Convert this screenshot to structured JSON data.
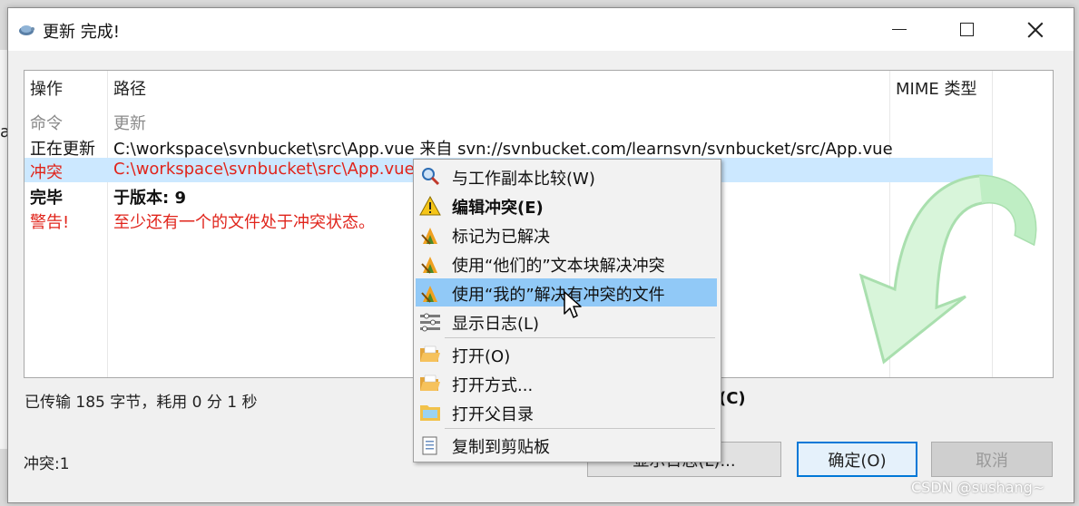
{
  "window": {
    "title": "更新 完成!"
  },
  "list": {
    "headers": {
      "op": "操作",
      "path": "路径",
      "mime": "MIME 类型"
    },
    "rows": [
      {
        "op": "命令",
        "path": "更新"
      },
      {
        "op": "正在更新",
        "path": "C:\\workspace\\svnbucket\\src\\App.vue 来自 svn://svnbucket.com/learnsvn/svnbucket/src/App.vue"
      },
      {
        "op": "冲突",
        "path": "C:\\workspace\\svnbucket\\src\\App.vue"
      },
      {
        "op": "完毕",
        "path": "于版本: 9"
      },
      {
        "op": "警告!",
        "path": "至少还有一个的文件处于冲突状态。"
      }
    ]
  },
  "status": {
    "transferred": "已传输 185 字节，耗用 0 分 1 秒",
    "conflicts": "冲突:1",
    "hidden_label": "(C)"
  },
  "buttons": {
    "show_log": "显示日志(L)...",
    "ok": "确定(O)",
    "cancel": "取消"
  },
  "context_menu": {
    "items": [
      {
        "label": "与工作副本比较(W)",
        "icon": "magnifier-icon"
      },
      {
        "label": "编辑冲突(E)",
        "icon": "warning-icon"
      },
      {
        "label": "标记为已解决",
        "icon": "tortoise-resolve-icon"
      },
      {
        "label": "使用“他们的”文本块解决冲突",
        "icon": "tortoise-resolve-icon"
      },
      {
        "label": "使用“我的”解决有冲突的文件",
        "icon": "tortoise-resolve-icon"
      },
      {
        "label": "显示日志(L)",
        "icon": "log-icon"
      },
      {
        "label": "打开(O)",
        "icon": "folder-open-icon"
      },
      {
        "label": "打开方式...",
        "icon": "folder-open-icon"
      },
      {
        "label": "打开父目录",
        "icon": "folder-icon"
      },
      {
        "label": "复制到剪贴板",
        "icon": "clipboard-icon"
      }
    ]
  },
  "watermark": "CSDN @sushang~",
  "colors": {
    "conflict_text": "#e0241b",
    "selection": "#cce8ff",
    "menu_highlight": "#91c9f7"
  }
}
